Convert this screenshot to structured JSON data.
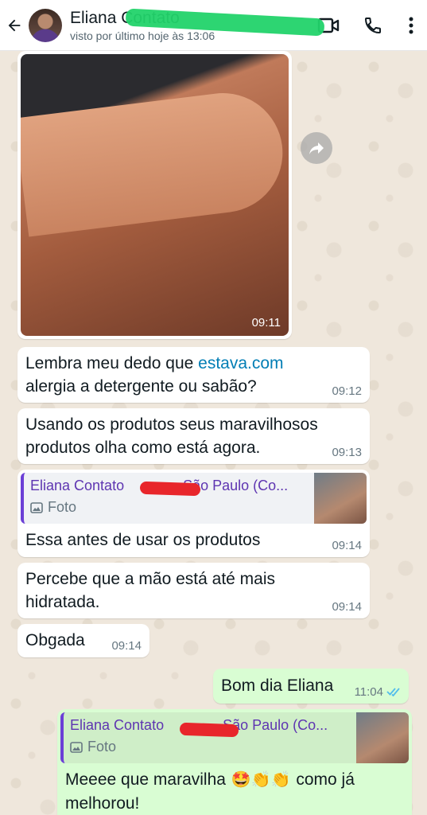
{
  "header": {
    "contact_name": "Eliana Contato",
    "last_seen": "visto por último hoje às 13:06"
  },
  "messages": {
    "photo_time": "09:11",
    "m1": {
      "text_before": "Lembra meu dedo que ",
      "link": "estava.com",
      "text_after": " alergia a detergente ou sabão?",
      "time": "09:12"
    },
    "m2": {
      "text": "Usando os produtos seus maravilhosos produtos olha como está agora.",
      "time": "09:13"
    },
    "m3": {
      "quote_name_a": "Eliana Contato",
      "quote_name_b": "São Paulo (Co...",
      "quote_type": "Foto",
      "text": "Essa antes de usar os produtos",
      "time": "09:14"
    },
    "m4": {
      "text": "Percebe que a mão está até mais hidratada.",
      "time": "09:14"
    },
    "m5": {
      "text": "Obgada",
      "time": "09:14"
    },
    "m6": {
      "text": "Bom dia Eliana",
      "time": "11:04"
    },
    "m7": {
      "quote_name_a": "Eliana Contato",
      "quote_name_b": "São Paulo (Co...",
      "quote_type": "Foto",
      "text_before": "Meeee que maravilha ",
      "emojis": "🤩👏👏",
      "text_after": " como já melhorou!"
    }
  },
  "colors": {
    "accent_purple": "#6b3fd6",
    "outgoing_bubble": "#d9fdd3",
    "read_ticks": "#53bdeb",
    "link": "#027eb5"
  }
}
